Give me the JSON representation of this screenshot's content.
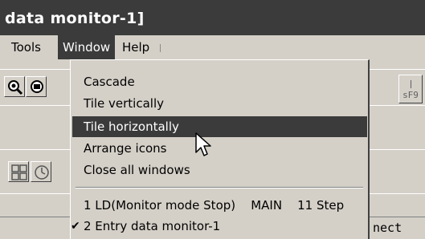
{
  "window": {
    "title": "data monitor-1]"
  },
  "menubar": {
    "items": [
      {
        "label": "Tools"
      },
      {
        "label": "Window"
      },
      {
        "label": "Help"
      }
    ]
  },
  "dropdown": {
    "items": [
      {
        "label": "Cascade"
      },
      {
        "label": "Tile vertically"
      },
      {
        "label": "Tile horizontally"
      },
      {
        "label": "Arrange icons"
      },
      {
        "label": "Close all windows"
      }
    ],
    "windows": [
      {
        "label": "1 LD(Monitor mode Stop)    MAIN    11 Step",
        "checked": false
      },
      {
        "label": "2 Entry data monitor-1",
        "checked": true
      }
    ],
    "check_glyph": "✔"
  },
  "toolbar": {
    "fkey_label": "sF9",
    "icons": [
      "zoom-icon",
      "print-icon",
      "grid-icon",
      "clock-icon"
    ]
  },
  "statusbar": {
    "right_text": "nect"
  },
  "colors": {
    "highlight": "#3b3b3b",
    "face": "#d4d0c8"
  }
}
